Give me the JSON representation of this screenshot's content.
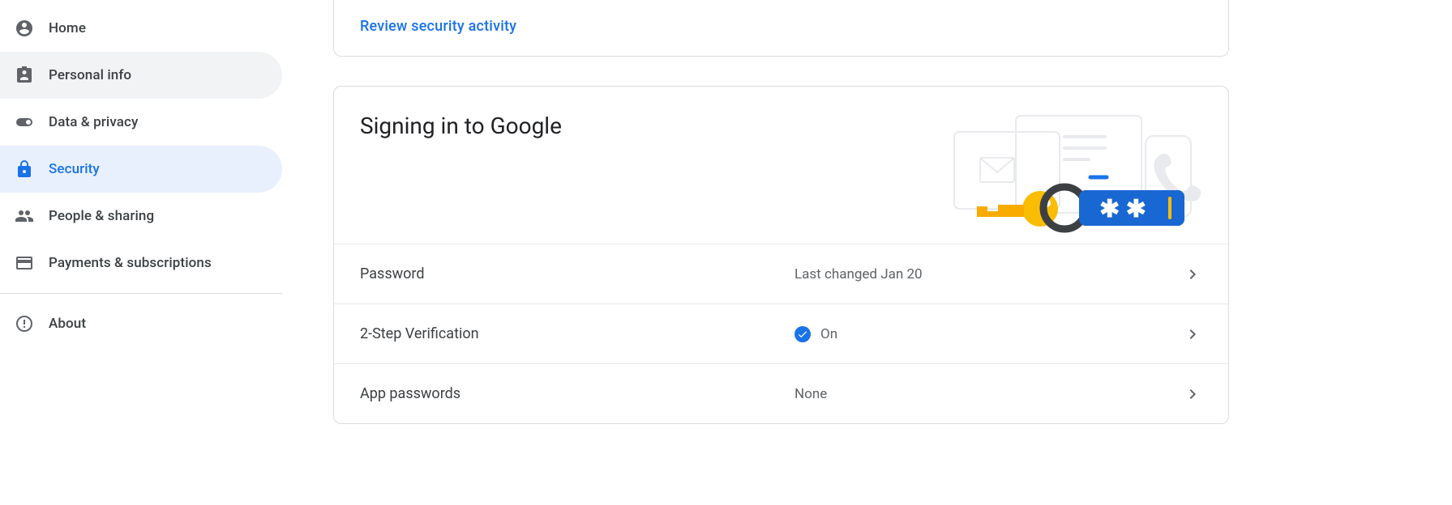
{
  "sidebar": {
    "items": [
      {
        "label": "Home",
        "icon": "home"
      },
      {
        "label": "Personal info",
        "icon": "id-card"
      },
      {
        "label": "Data & privacy",
        "icon": "toggle"
      },
      {
        "label": "Security",
        "icon": "lock"
      },
      {
        "label": "People & sharing",
        "icon": "people"
      },
      {
        "label": "Payments & subscriptions",
        "icon": "card"
      },
      {
        "label": "About",
        "icon": "info"
      }
    ]
  },
  "top_card": {
    "review_link": "Review security activity"
  },
  "signin_card": {
    "title": "Signing in to Google",
    "rows": [
      {
        "label": "Password",
        "value": "Last changed Jan 20",
        "status": ""
      },
      {
        "label": "2-Step Verification",
        "value": "On",
        "status": "on"
      },
      {
        "label": "App passwords",
        "value": "None",
        "status": ""
      }
    ]
  }
}
